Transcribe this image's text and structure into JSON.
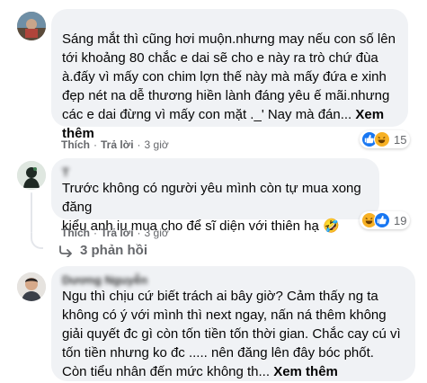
{
  "comments": [
    {
      "author": "",
      "text_lines": [
        "Sáng mắt thì cũng hơi muộn.nhưng may nếu con số lên",
        "tới khoảng 80 chắc e dai sẽ cho e này ra trò chứ đùa",
        "à.đấy vì mấy con chim lợn thế này mà mấy đứa e xinh",
        "đẹp nét na dễ thương hiền lành đáng yêu ế mãi.nhưng",
        "các e dai đừng vì mấy con mặt ._' Nay mà đán..."
      ],
      "see_more": "Xem",
      "see_more_2": "thêm",
      "actions": {
        "like": "Thích",
        "reply": "Trả lời",
        "time": "3 giờ"
      },
      "reaction_count": "15",
      "reaction_icons": [
        "like-icon",
        "haha-icon"
      ]
    },
    {
      "author": "T",
      "text_lines": [
        "Trước không có người yêu mình còn tự mua xong đăng",
        "kiểu anh iu mua cho để sĩ diện với thiên hạ 🤣"
      ],
      "actions": {
        "like": "Thích",
        "reply": "Trả lời",
        "time": "3 giờ"
      },
      "reaction_count": "19",
      "reaction_icons": [
        "haha-icon",
        "like-icon"
      ],
      "replies_label": "3 phản hồi"
    },
    {
      "author": "Dương Nguyễn",
      "text_lines": [
        "Ngu thì chịu cứ biết trách ai bây giờ? Cảm thấy ng ta",
        "không có ý với mình thì next ngay, nấn ná thêm không",
        "giải quyết đc gì còn tốn tiền tốn thời gian. Chắc cay cú vì",
        "tốn tiền nhưng ko đc ..... nên đăng lên đây bóc phốt.",
        "Còn tiểu nhân đến mức không th... "
      ],
      "see_more": "Xem thêm"
    }
  ]
}
